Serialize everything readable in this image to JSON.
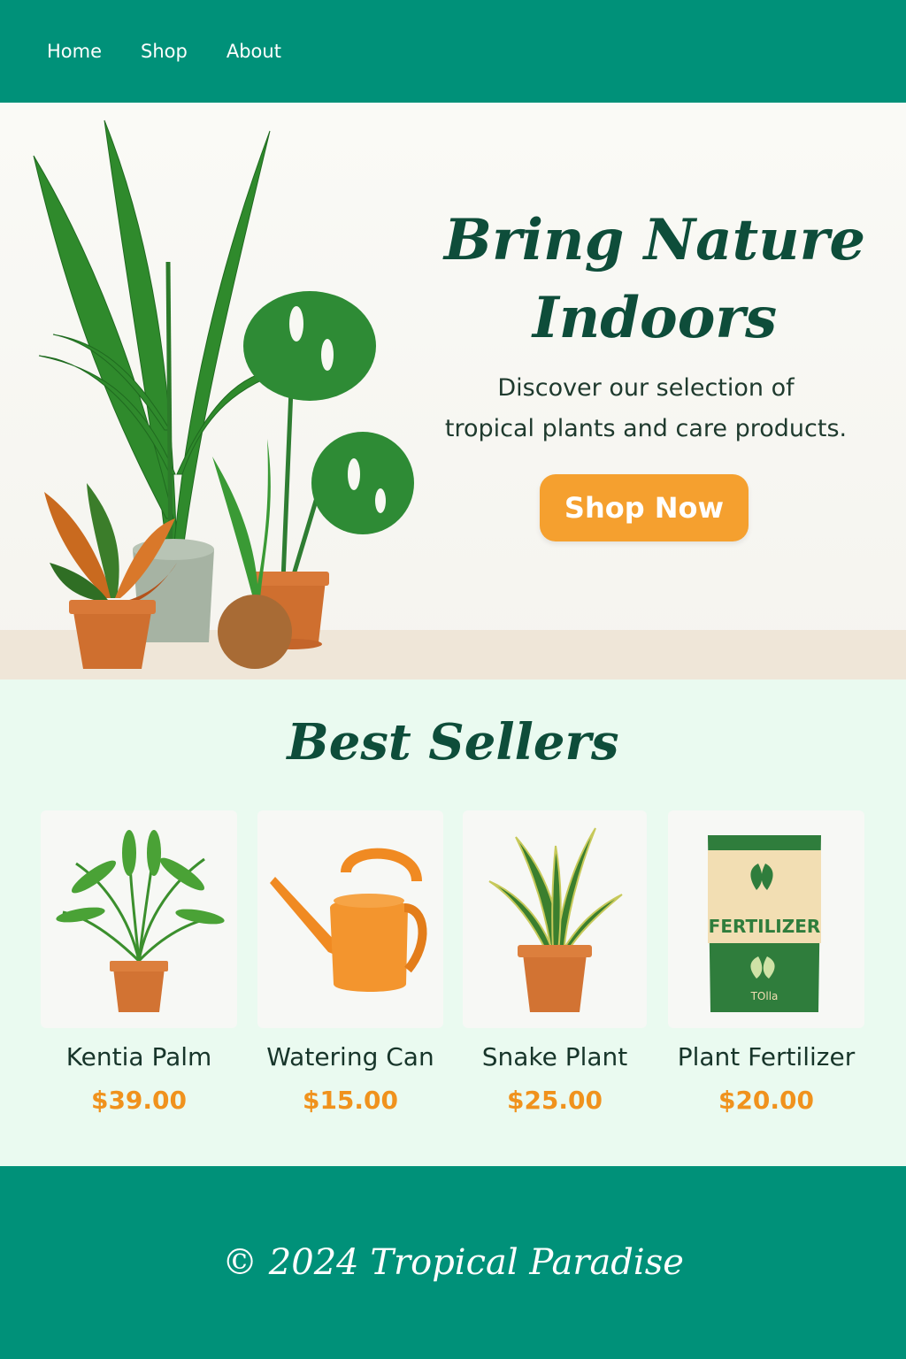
{
  "theme": {
    "primary": "#009179",
    "dark_green": "#0e4d3a",
    "accent_orange": "#f5a02f",
    "price_orange": "#f0921d",
    "section_bg": "#eafaf0"
  },
  "nav": {
    "items": [
      {
        "label": "Home"
      },
      {
        "label": "Shop"
      },
      {
        "label": "About"
      }
    ]
  },
  "hero": {
    "title_line1": "Bring Nature",
    "title_line2": "Indoors",
    "subtitle_line1": "Discover our selection of",
    "subtitle_line2": "tropical plants and care products.",
    "cta_label": "Shop Now"
  },
  "best_sellers": {
    "title": "Best Sellers",
    "products": [
      {
        "name": "Kentia Palm",
        "price": "$39.00",
        "icon": "kentia-palm-image"
      },
      {
        "name": "Watering Can",
        "price": "$15.00",
        "icon": "watering-can-image"
      },
      {
        "name": "Snake Plant",
        "price": "$25.00",
        "icon": "snake-plant-image"
      },
      {
        "name": "Plant Fertilizer",
        "price": "$20.00",
        "icon": "fertilizer-bag-image",
        "package_title": "FERTILIZER",
        "package_brand": "TOlla"
      }
    ]
  },
  "footer": {
    "text": "© 2024 Tropical Paradise"
  }
}
